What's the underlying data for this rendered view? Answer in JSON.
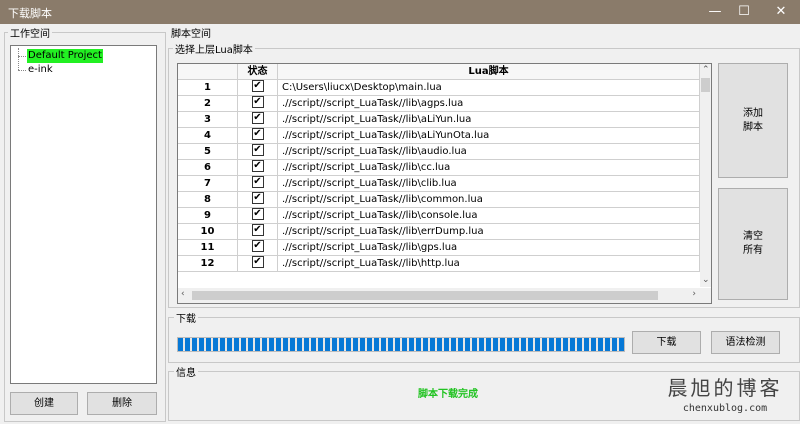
{
  "window": {
    "title": "下载脚本",
    "minimize": "—",
    "maximize": "☐",
    "close": "✕"
  },
  "workspace": {
    "label": "工作空间",
    "projects": [
      "Default Project",
      "e-ink"
    ],
    "create_label": "创建",
    "delete_label": "删除"
  },
  "script_space": {
    "label": "脚本空间",
    "group_label": "选择上层Lua脚本",
    "columns": {
      "number": "",
      "status": "状态",
      "script": "Lua脚本"
    },
    "rows": [
      {
        "num": "1",
        "checked": "✔",
        "path": "C:\\Users\\liucx\\Desktop\\main.lua"
      },
      {
        "num": "2",
        "checked": "✔",
        "path": ".//script//script_LuaTask//lib\\agps.lua"
      },
      {
        "num": "3",
        "checked": "✔",
        "path": ".//script//script_LuaTask//lib\\aLiYun.lua"
      },
      {
        "num": "4",
        "checked": "✔",
        "path": ".//script//script_LuaTask//lib\\aLiYunOta.lua"
      },
      {
        "num": "5",
        "checked": "✔",
        "path": ".//script//script_LuaTask//lib\\audio.lua"
      },
      {
        "num": "6",
        "checked": "✔",
        "path": ".//script//script_LuaTask//lib\\cc.lua"
      },
      {
        "num": "7",
        "checked": "✔",
        "path": ".//script//script_LuaTask//lib\\clib.lua"
      },
      {
        "num": "8",
        "checked": "✔",
        "path": ".//script//script_LuaTask//lib\\common.lua"
      },
      {
        "num": "9",
        "checked": "✔",
        "path": ".//script//script_LuaTask//lib\\console.lua"
      },
      {
        "num": "10",
        "checked": "✔",
        "path": ".//script//script_LuaTask//lib\\errDump.lua"
      },
      {
        "num": "11",
        "checked": "✔",
        "path": ".//script//script_LuaTask//lib\\gps.lua"
      },
      {
        "num": "12",
        "checked": "✔",
        "path": ".//script//script_LuaTask//lib\\http.lua"
      }
    ],
    "add_label": "添加\n脚本",
    "clear_label": "清空\n所有"
  },
  "download": {
    "label": "下载",
    "progress": 1.0,
    "download_label": "下载",
    "syntax_check_label": "语法检测"
  },
  "info": {
    "label": "信息",
    "message": "脚本下载完成"
  },
  "watermark": {
    "title": "晨旭的博客",
    "url": "chenxublog.com"
  },
  "colors": {
    "titlebar": "#8a7b6a",
    "selection": "#22f022",
    "progress": "#0678d6",
    "success": "#22c322"
  }
}
